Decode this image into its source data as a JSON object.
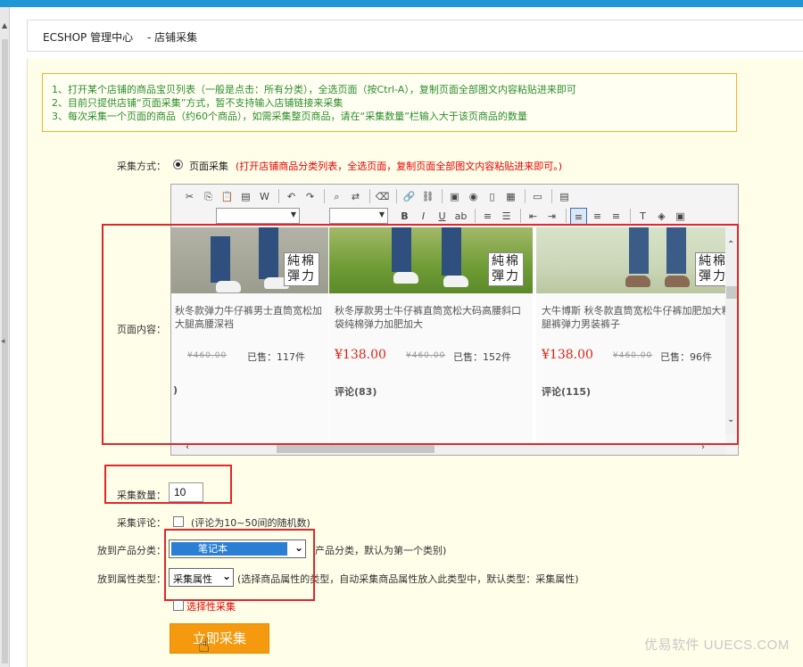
{
  "breadcrumb": {
    "app": "ECSHOP 管理中心",
    "page": "- 店铺采集"
  },
  "notice": [
    "1、打开某个店铺的商品宝贝列表（一般是点击：所有分类），全选页面（按Ctrl-A），复制页面全部图文内容粘贴进来即可",
    "2、目前只提供店铺“页面采集”方式，暂不支持输入店铺链接来采集",
    "3、每次采集一个页面的商品（约60个商品），如需采集整页商品，请在“采集数量”栏输入大于该页商品的数量"
  ],
  "form": {
    "method_label": "采集方式：",
    "method_option": "页面采集",
    "method_hint": "(打开店铺商品分类列表，全选页面，复制页面全部图文内容粘贴进来即可。)",
    "content_label": "页面内容：",
    "qty_label": "采集数量：",
    "qty_value": "10",
    "comment_label": "采集评论：",
    "comment_hint": "(评论为10~50间的随机数)",
    "category_label": "放到产品分类：",
    "category_value": "笔记本",
    "category_hint": "产品分类，默认为第一个类别)",
    "attr_label": "放到属性类型：",
    "attr_value": "采集属性",
    "attr_hint": "(选择商品属性的类型，自动采集商品属性放入此类型中，默认类型：采集属性)",
    "selective_label": "选择性采集",
    "submit_label": "立即采集"
  },
  "products": [
    {
      "name": "秋冬款弹力牛仔裤男士直筒宽松加大腿高腰深裆",
      "price": "",
      "old_price": "¥460.00",
      "sold": "已售：117件",
      "reviews": ")",
      "stamp": "純棉彈力"
    },
    {
      "name": "秋冬厚款男士牛仔裤直筒宽松大码高腰斜口袋纯棉弹力加肥加大",
      "price": "¥138.00",
      "old_price": "¥460.00",
      "sold": "已售：152件",
      "reviews": "评论(83)",
      "stamp": "純棉彈力"
    },
    {
      "name": "大牛博斯 秋冬款直筒宽松牛仔裤加肥加大粗腿裤弹力男装裤子",
      "price": "¥138.00",
      "old_price": "¥460.00",
      "sold": "已售：96件",
      "reviews": "评论(115)",
      "stamp": "純棉彈力"
    }
  ],
  "watermark": "优易软件 UUECS.COM",
  "colors": {
    "accent": "#1e96d8",
    "highlight": "#e3262b",
    "button": "#f59a0f",
    "notice_text": "#2d8d2d"
  }
}
